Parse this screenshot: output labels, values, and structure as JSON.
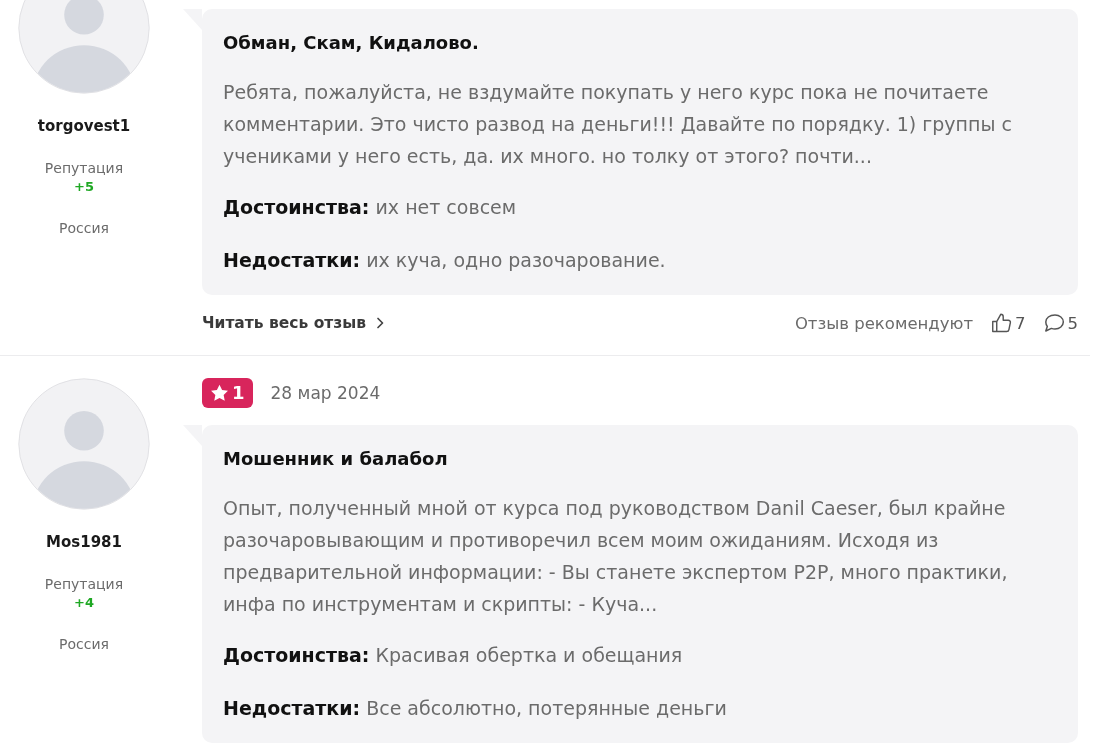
{
  "reviews": [
    {
      "author": {
        "name": "torgovest1",
        "reputation_label": "Репутация",
        "reputation": "+5",
        "country": "Россия"
      },
      "title": "Обман, Скам, Кидалово.",
      "text": "Ребята, пожалуйста, не вздумайте покупать у него курс пока не почитаете комментарии. Это чисто развод на деньги!!! Давайте по порядку. 1) группы с учениками у него есть, да. их много. но толку от этого? почти...",
      "pros": {
        "label": "Достоинства:",
        "value": "их нет совсем"
      },
      "cons": {
        "label": "Недостатки:",
        "value": "их куча, одно разочарование."
      },
      "footer": {
        "read_more": "Читать весь отзыв",
        "recommend_label": "Отзыв рекомендуют",
        "likes": "7",
        "comments": "5"
      }
    },
    {
      "rating": "1",
      "date": "28 мар 2024",
      "author": {
        "name": "Mos1981",
        "reputation_label": "Репутация",
        "reputation": "+4",
        "country": "Россия"
      },
      "title": "Мошенник и балабол",
      "text": "Опыт, полученный мной от курса под руководством Danil Caeser, был крайне разочаровывающим и противоречил всем моим ожиданиям. Исходя из предварительной информации: - Вы станете экспертом P2P, много практики, инфа по инструментам и скрипты: - Куча...",
      "pros": {
        "label": "Достоинства:",
        "value": "Красивая обертка и обещания"
      },
      "cons": {
        "label": "Недостатки:",
        "value": "Все абсолютно, потерянные деньги"
      }
    }
  ]
}
